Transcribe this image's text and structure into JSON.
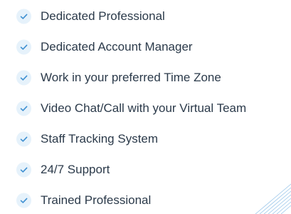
{
  "features": {
    "items": [
      {
        "label": "Dedicated Professional"
      },
      {
        "label": "Dedicated Account Manager"
      },
      {
        "label": "Work in your preferred Time Zone"
      },
      {
        "label": "Video Chat/Call with your Virtual Team"
      },
      {
        "label": "Staff Tracking System"
      },
      {
        "label": "24/7 Support"
      },
      {
        "label": "Trained Professional"
      }
    ],
    "icon": "check-icon"
  },
  "colors": {
    "check_background": "#e6f2fb",
    "check_mark": "#3d8fd1",
    "text": "#2b3a4a",
    "decoration": "#9cc7ea"
  }
}
